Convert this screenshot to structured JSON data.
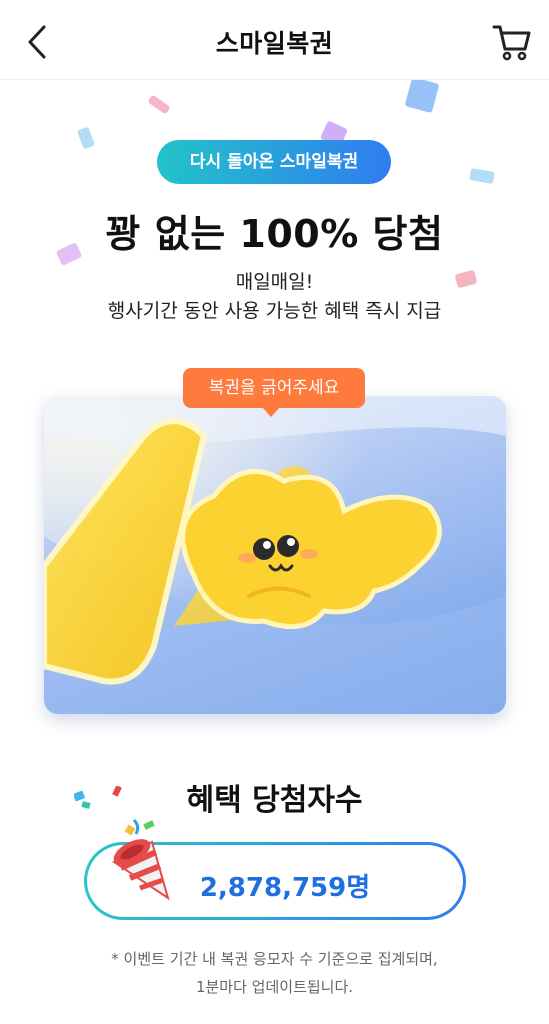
{
  "header": {
    "title": "스마일복권",
    "back_icon": "chevron-left-icon",
    "cart_icon": "cart-icon"
  },
  "event": {
    "badge": "다시 돌아온 스마일복권",
    "title": "꽝 없는 100% 당첨",
    "subtitle_line1": "매일매일!",
    "subtitle_line2": "행사기간 동안 사용 가능한 혜택 즉시 지급",
    "scratch_tooltip": "복권을 긁어주세요"
  },
  "winners": {
    "title": "혜택 당첨자수",
    "count": "2,878,759명"
  },
  "footnote": {
    "line1": "* 이벤트 기간 내 복권 응모자 수 기준으로 집계되며,",
    "line2": "1분마다 업데이트됩니다."
  },
  "colors": {
    "badge_gradient_start": "#23c3c8",
    "badge_gradient_end": "#2f7df0",
    "tooltip": "#ff7a3d",
    "count_text": "#1f6fe0"
  }
}
